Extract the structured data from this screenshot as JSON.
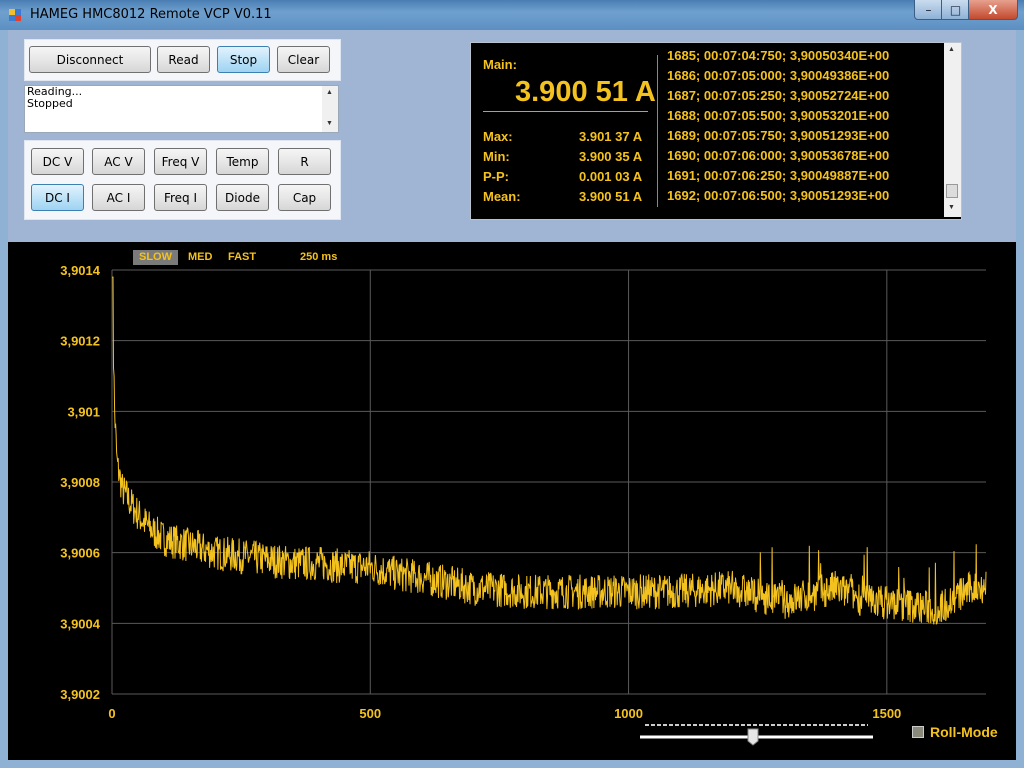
{
  "window": {
    "title": "HAMEG HMC8012 Remote VCP V0.11",
    "minimize": "–",
    "maximize": "□",
    "close": "X"
  },
  "controls": {
    "disconnect": "Disconnect",
    "read": "Read",
    "stop": "Stop",
    "clear": "Clear"
  },
  "status_lines": [
    "Reading...",
    "Stopped"
  ],
  "modes": {
    "dc_v": "DC V",
    "ac_v": "AC V",
    "freq_v": "Freq V",
    "temp": "Temp",
    "r": "R",
    "dc_i": "DC I",
    "ac_i": "AC I",
    "freq_i": "Freq I",
    "diode": "Diode",
    "cap": "Cap"
  },
  "readout": {
    "main_label": "Main:",
    "main_value": "3.900 51 A",
    "max_label": "Max:",
    "max_value": "3.901 37 A",
    "min_label": "Min:",
    "min_value": "3.900 35 A",
    "pp_label": "P-P:",
    "pp_value": "0.001 03 A",
    "mean_label": "Mean:",
    "mean_value": "3.900 51 A"
  },
  "log": [
    "1685; 00:07:04:750; 3,90050340E+00",
    "1686; 00:07:05:000; 3,90049386E+00",
    "1687; 00:07:05:250; 3,90052724E+00",
    "1688; 00:07:05:500; 3,90053201E+00",
    "1689; 00:07:05:750; 3,90051293E+00",
    "1690; 00:07:06:000; 3,90053678E+00",
    "1691; 00:07:06:250; 3,90049887E+00",
    "1692; 00:07:06:500; 3,90051293E+00"
  ],
  "speed": {
    "slow": "SLOW",
    "med": "MED",
    "fast": "FAST",
    "interval": "250 ms"
  },
  "roll_mode": "Roll-Mode",
  "colors": {
    "trace": "#f4c21f",
    "grid": "#5a5a5a",
    "titlebar": "#5c8fc2"
  },
  "chart_data": {
    "type": "line",
    "xlim": [
      0,
      1692
    ],
    "ylim": [
      3.9002,
      3.9014
    ],
    "x_ticks": [
      "0",
      "500",
      "1000",
      "1500"
    ],
    "y_ticks": [
      "3,9002",
      "3,9004",
      "3,9006",
      "3,9008",
      "3,901",
      "3,9012",
      "3,9014"
    ],
    "grid": true,
    "series": [
      {
        "x": [
          0,
          5,
          10,
          20,
          40,
          60,
          80,
          100,
          150,
          200,
          250,
          300,
          350,
          400,
          450,
          500,
          550,
          600,
          700,
          800,
          900,
          1000,
          1100,
          1200,
          1250,
          1300,
          1350,
          1400,
          1450,
          1500,
          1550,
          1600,
          1650,
          1692
        ],
        "values": [
          3.90138,
          3.901,
          3.90085,
          3.90078,
          3.90073,
          3.90069,
          3.90066,
          3.90064,
          3.90062,
          3.9006,
          3.90059,
          3.90058,
          3.90057,
          3.90057,
          3.90056,
          3.90056,
          3.90054,
          3.90053,
          3.9005,
          3.90049,
          3.90049,
          3.90049,
          3.90049,
          3.9005,
          3.90048,
          3.90046,
          3.90048,
          3.9005,
          3.90047,
          3.90046,
          3.90045,
          3.90044,
          3.90049,
          3.90051
        ]
      }
    ]
  }
}
